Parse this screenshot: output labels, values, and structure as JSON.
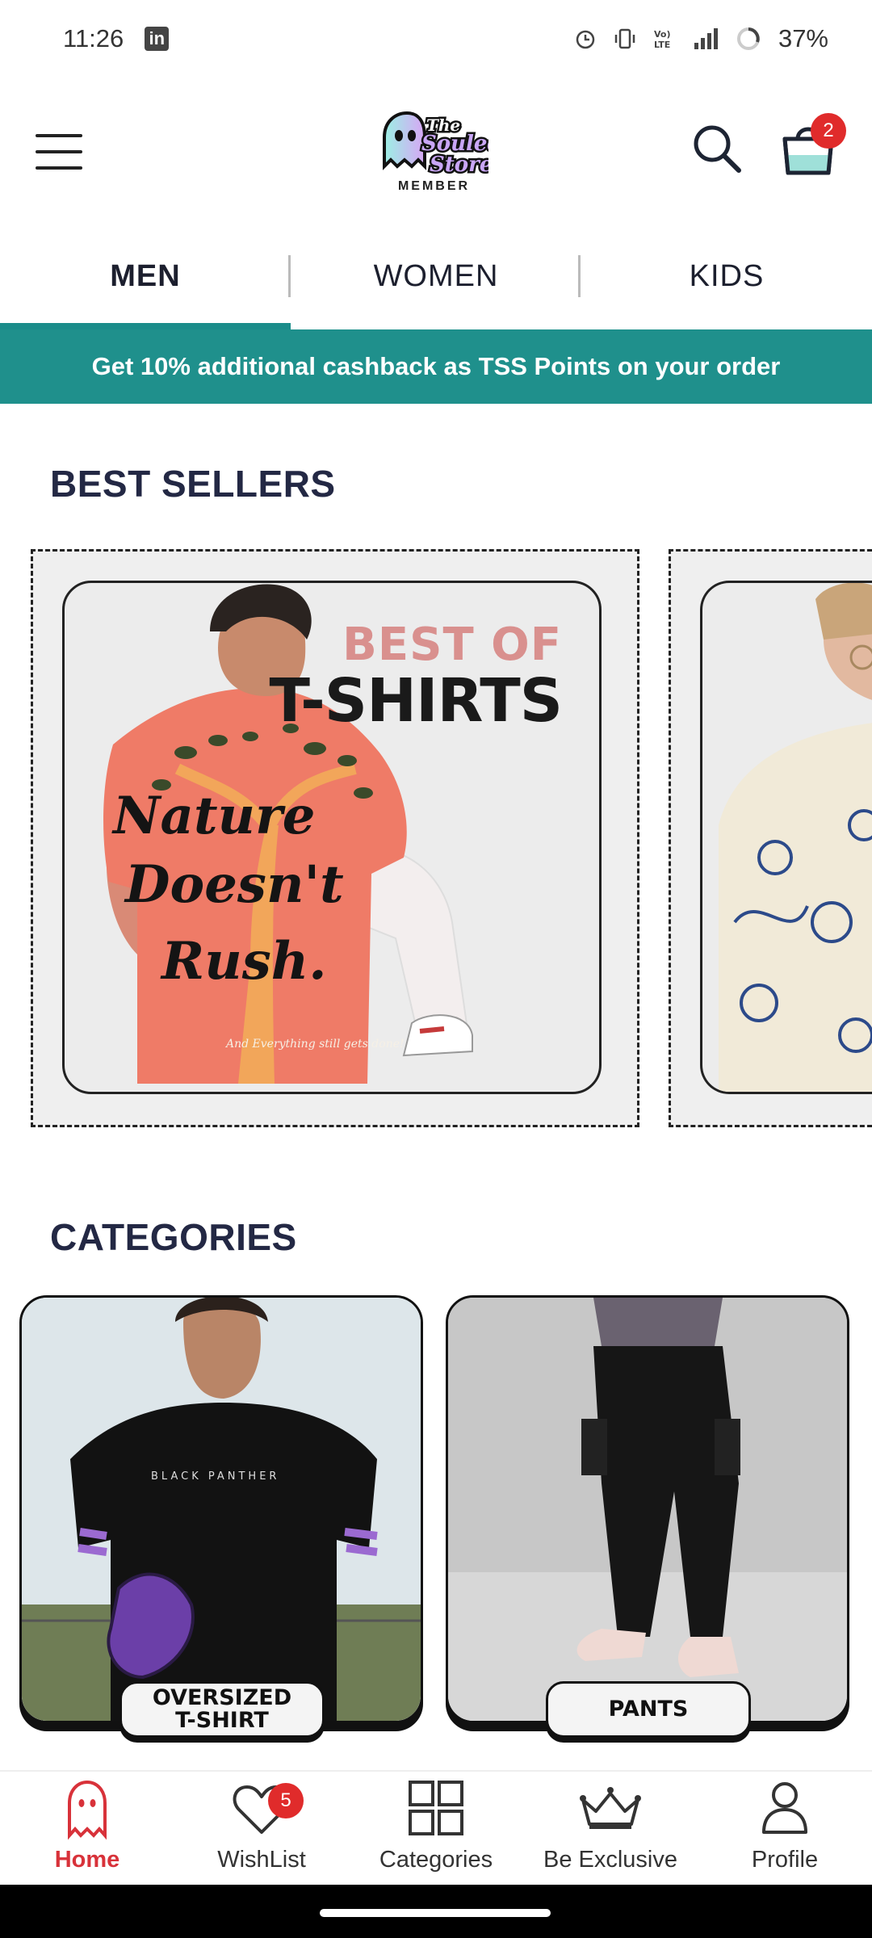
{
  "status_bar": {
    "time": "11:26",
    "notification_app": "in",
    "battery": "37%",
    "icons": [
      "alarm-icon",
      "vibrate-icon",
      "volte-icon",
      "signal-icon",
      "battery-icon"
    ]
  },
  "header": {
    "logo_text": "The Souled Store",
    "logo_badge": "MEMBER",
    "cart_count": "2"
  },
  "gender_tabs": [
    {
      "label": "MEN",
      "active": true
    },
    {
      "label": "WOMEN",
      "active": false
    },
    {
      "label": "KIDS",
      "active": false
    }
  ],
  "promo_bar": {
    "text": "Get 10% additional cashback as TSS Points on your order",
    "color": "#1f908c"
  },
  "best_sellers": {
    "title": "BEST SELLERS",
    "cards": [
      {
        "subtitle": "BEST OF",
        "headline": "T-SHIRTS",
        "tee_line_1": "Nature",
        "tee_line_2": "Doesn't",
        "tee_line_3": "Rush.",
        "tee_small": "And Everything still gets done!"
      },
      {
        "subtitle": "",
        "headline": ""
      }
    ]
  },
  "categories": {
    "title": "CATEGORIES",
    "items": [
      {
        "label_line_1": "OVERSIZED",
        "label_line_2": "T-SHIRT",
        "tee_text": "BLACK PANTHER"
      },
      {
        "label_line_1": "PANTS",
        "label_line_2": ""
      }
    ]
  },
  "bottom_nav": {
    "items": [
      {
        "label": "Home",
        "icon": "ghost-icon",
        "active": true
      },
      {
        "label": "WishList",
        "icon": "heart-icon",
        "badge": "5"
      },
      {
        "label": "Categories",
        "icon": "grid-icon"
      },
      {
        "label": "Be Exclusive",
        "icon": "crown-icon"
      },
      {
        "label": "Profile",
        "icon": "user-icon"
      }
    ]
  },
  "colors": {
    "accent_teal": "#1f908c",
    "active_red": "#d8323a",
    "badge_red": "#e02b2b",
    "heading_navy": "#232844"
  }
}
